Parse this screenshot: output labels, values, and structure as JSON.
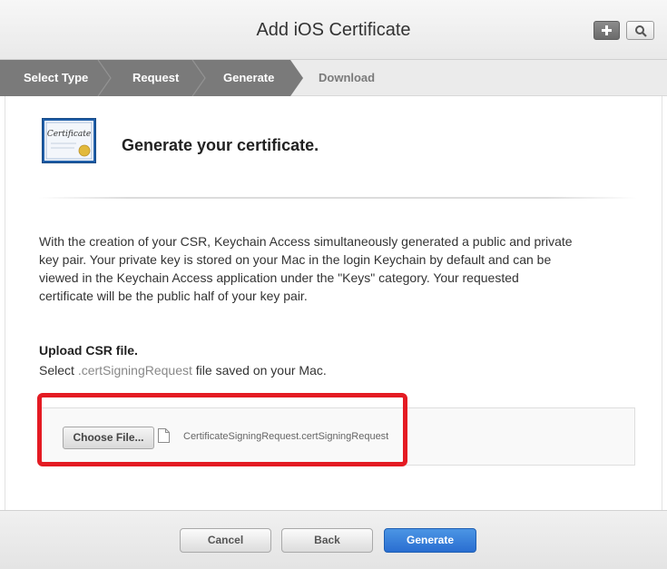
{
  "header": {
    "title": "Add iOS Certificate",
    "add_icon": "plus-icon",
    "search_icon": "search-icon"
  },
  "steps": [
    {
      "label": "Select Type",
      "state": "done"
    },
    {
      "label": "Request",
      "state": "done"
    },
    {
      "label": "Generate",
      "state": "done"
    },
    {
      "label": "Download",
      "state": "pending"
    }
  ],
  "main": {
    "icon": "certificate-icon",
    "heading": "Generate your certificate.",
    "description_lines": [
      "With the creation of your CSR, Keychain Access simultaneously generated a public and private",
      "key pair. Your private key is stored on your Mac in the login Keychain by default and can be",
      "viewed in the Keychain Access application under the \"Keys\" category. Your requested",
      "certificate will be the public half of your key pair."
    ],
    "upload": {
      "title": "Upload CSR file.",
      "sub_prefix": "Select ",
      "sub_ext": ".certSigningRequest",
      "sub_suffix": " file saved on your Mac.",
      "choose_label": "Choose File...",
      "file_icon": "document-icon",
      "file_name": "CertificateSigningRequest.certSigningRequest"
    }
  },
  "footer": {
    "cancel_label": "Cancel",
    "back_label": "Back",
    "generate_label": "Generate"
  },
  "colors": {
    "steps_done": "#7a7a7a",
    "highlight": "#e41b23",
    "primary": "#2a6ed1"
  }
}
